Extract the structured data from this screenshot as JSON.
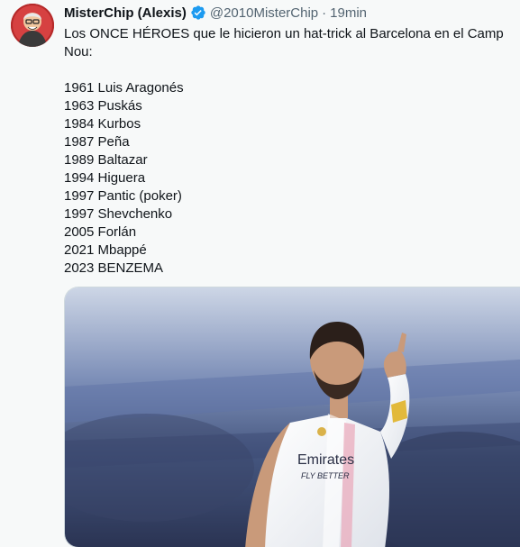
{
  "tweet": {
    "display_name": "MisterChip (Alexis)",
    "handle": "@2010MisterChip",
    "separator": "·",
    "time": "19min",
    "verified_icon": "verified-badge-icon",
    "text": "Los ONCE HÉROES que le hicieron un hat-trick al Barcelona en el Camp Nou:\n\n1961 Luis Aragonés\n1963 Puskás\n1984 Kurbos\n1987 Peña\n1989 Baltazar\n1994 Higuera\n1997 Pantic (poker)\n1997 Shevchenko\n2005 Forlán\n2021 Mbappé\n2023 BENZEMA",
    "media": {
      "jersey_sponsor": "Emirates",
      "jersey_slogan": "FLY BETTER"
    }
  },
  "colors": {
    "background": "#f7f9f9",
    "verified_blue": "#1d9bf0",
    "secondary_text": "#536471"
  }
}
